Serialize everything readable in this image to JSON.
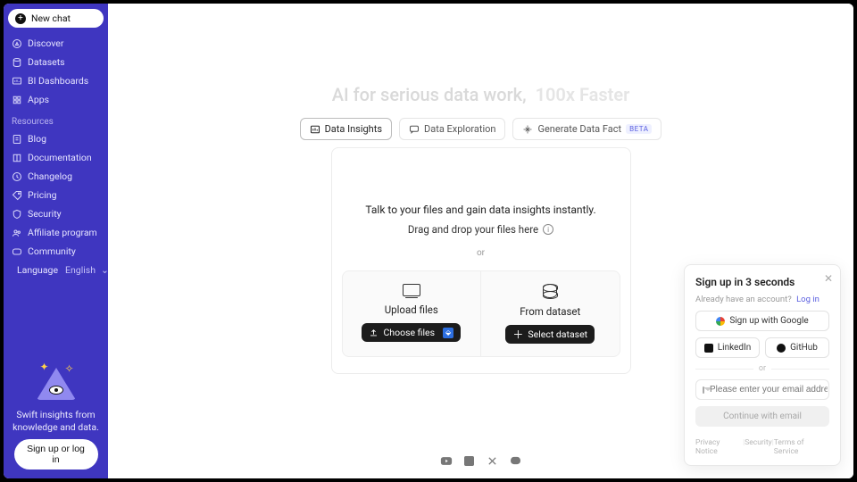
{
  "sidebar": {
    "new_chat": "New chat",
    "nav": [
      {
        "label": "Discover"
      },
      {
        "label": "Datasets"
      },
      {
        "label": "BI Dashboards"
      },
      {
        "label": "Apps"
      }
    ],
    "resources_header": "Resources",
    "resources": [
      {
        "label": "Blog"
      },
      {
        "label": "Documentation"
      },
      {
        "label": "Changelog"
      },
      {
        "label": "Pricing"
      },
      {
        "label": "Security"
      },
      {
        "label": "Affiliate program"
      },
      {
        "label": "Community"
      }
    ],
    "language_label": "Language",
    "language_value": "English",
    "tagline": "Swift insights from knowledge and data.",
    "login": "Sign up or log in"
  },
  "hero": {
    "line": "AI for serious data work,",
    "fast": "100x Faster"
  },
  "tabs": [
    {
      "label": "Data Insights",
      "active": true
    },
    {
      "label": "Data Exploration",
      "active": false
    },
    {
      "label": "Generate Data Fact",
      "active": false,
      "badge": "BETA"
    }
  ],
  "panel": {
    "headline": "Talk to your files and gain data insights instantly.",
    "dragline": "Drag and drop your files here",
    "or": "or",
    "upload": {
      "title": "Upload files",
      "button": "Choose files"
    },
    "dataset": {
      "title": "From dataset",
      "button": "Select dataset"
    }
  },
  "signup": {
    "title": "Sign up in 3 seconds",
    "already": "Already have an account?",
    "login_link": "Log in",
    "google": "Sign up with Google",
    "linkedin": "LinkedIn",
    "github": "GitHub",
    "or": "or",
    "email_placeholder": "Please enter your email address",
    "continue": "Continue with email",
    "legal": {
      "privacy": "Privacy Notice",
      "security": "Security",
      "tos": "Terms of Service"
    }
  }
}
